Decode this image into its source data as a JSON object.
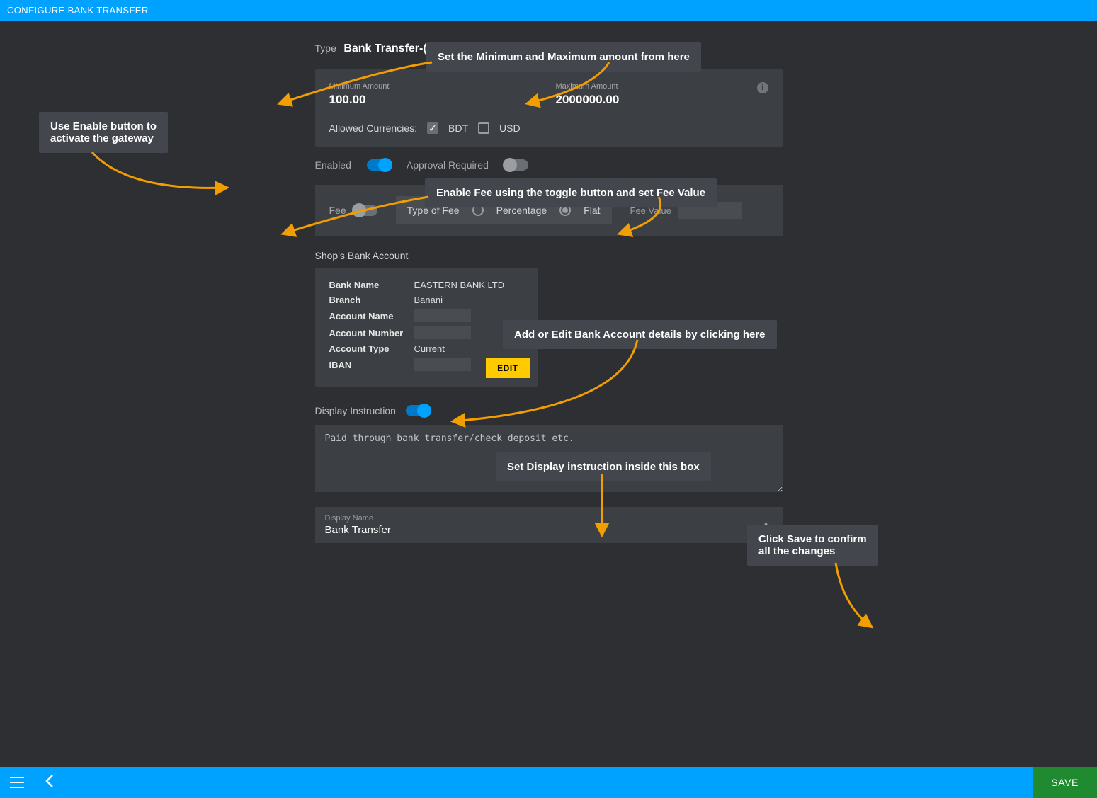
{
  "topbar": {
    "title": "CONFIGURE BANK TRANSFER"
  },
  "typeLabel": "Type",
  "typeValue": "Bank Transfer-(Bank Transfer)",
  "minAmount": {
    "label": "Minimum Amount",
    "value": "100.00"
  },
  "maxAmount": {
    "label": "Maximum Amount",
    "value": "2000000.00"
  },
  "allowedCurrenciesLabel": "Allowed Currencies:",
  "currencies": {
    "bdt": "BDT",
    "usd": "USD"
  },
  "enabledLabel": "Enabled",
  "approvalLabel": "Approval Required",
  "feeLabel": "Fee",
  "typeOfFeeLabel": "Type of Fee",
  "feePercentage": "Percentage",
  "feeFlat": "Flat",
  "feeValueLabel": "Fee Value",
  "shopBankAccountLabel": "Shop's Bank Account",
  "bank": {
    "bankNameLbl": "Bank Name",
    "bankName": "EASTERN BANK LTD",
    "branchLbl": "Branch",
    "branch": "Banani",
    "accountNameLbl": "Account Name",
    "accountName": "",
    "accountNumberLbl": "Account Number",
    "accountNumber": "",
    "accountTypeLbl": "Account Type",
    "accountType": "Current",
    "ibanLbl": "IBAN",
    "iban": ""
  },
  "editBtn": "EDIT",
  "displayInstructionLabel": "Display Instruction",
  "displayInstructionText": "Paid through bank transfer/check deposit etc.",
  "displayName": {
    "label": "Display Name",
    "value": "Bank Transfer"
  },
  "saveBtn": "SAVE",
  "annotations": {
    "enable": "Use Enable button to\nactivate the gateway",
    "minmax": "Set the Minimum and Maximum amount from here",
    "fee": "Enable Fee using the toggle button and set Fee Value",
    "bank": "Add or Edit Bank Account details by clicking here",
    "display": "Set Display instruction inside this box",
    "save": "Click Save to confirm\nall the changes"
  }
}
